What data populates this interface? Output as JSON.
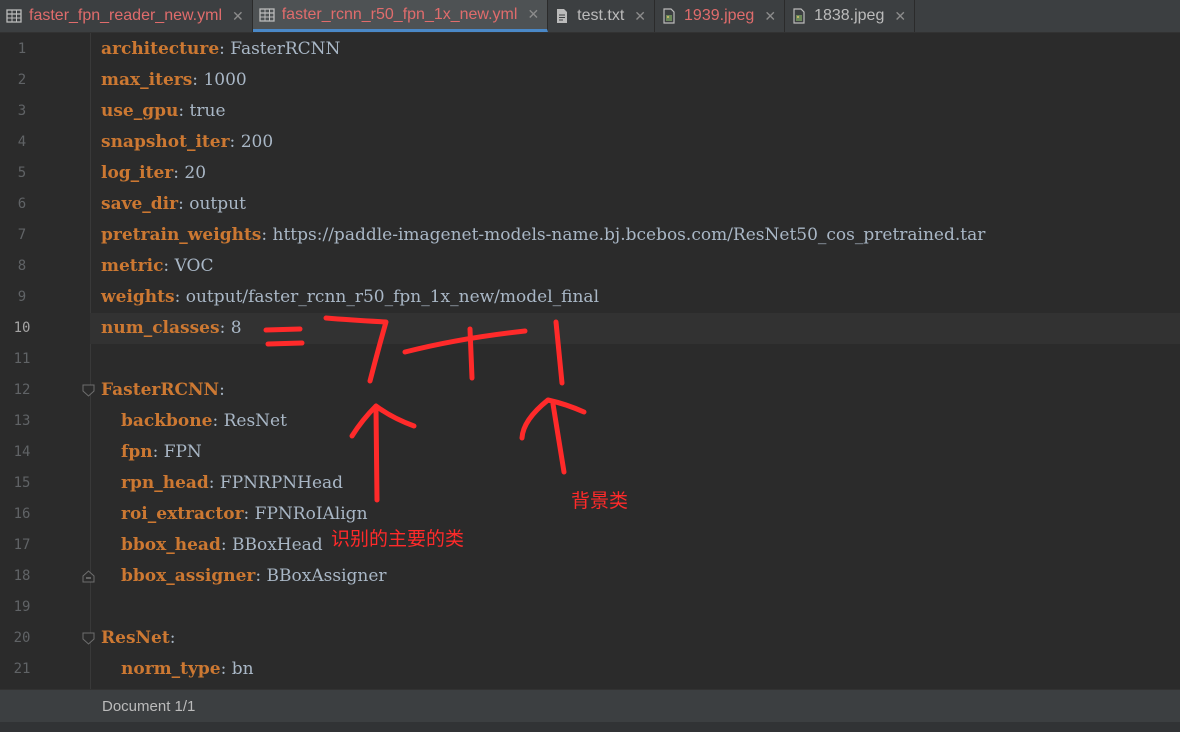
{
  "tabs": [
    {
      "label": "faster_fpn_reader_new.yml",
      "icon": "table-icon",
      "color": "#e06c6c",
      "active": false
    },
    {
      "label": "faster_rcnn_r50_fpn_1x_new.yml",
      "icon": "table-icon",
      "color": "#e06c6c",
      "active": true
    },
    {
      "label": "test.txt",
      "icon": "text-file-icon",
      "color": "#bbbbbb",
      "active": false
    },
    {
      "label": "1939.jpeg",
      "icon": "image-file-icon",
      "color": "#e06c6c",
      "active": false
    },
    {
      "label": "1838.jpeg",
      "icon": "image-file-icon",
      "color": "#bbbbbb",
      "active": false
    }
  ],
  "editor": {
    "current_line": 10,
    "lines": [
      {
        "num": "1",
        "indent": 0,
        "key": "architecture",
        "value": "FasterRCNN"
      },
      {
        "num": "2",
        "indent": 0,
        "key": "max_iters",
        "value": "1000"
      },
      {
        "num": "3",
        "indent": 0,
        "key": "use_gpu",
        "value": "true"
      },
      {
        "num": "4",
        "indent": 0,
        "key": "snapshot_iter",
        "value": "200"
      },
      {
        "num": "5",
        "indent": 0,
        "key": "log_iter",
        "value": "20"
      },
      {
        "num": "6",
        "indent": 0,
        "key": "save_dir",
        "value": "output"
      },
      {
        "num": "7",
        "indent": 0,
        "key": "pretrain_weights",
        "value": "https://paddle-imagenet-models-name.bj.bcebos.com/ResNet50_cos_pretrained.tar"
      },
      {
        "num": "8",
        "indent": 0,
        "key": "metric",
        "value": "VOC"
      },
      {
        "num": "9",
        "indent": 0,
        "key": "weights",
        "value": "output/faster_rcnn_r50_fpn_1x_new/model_final"
      },
      {
        "num": "10",
        "indent": 0,
        "key": "num_classes",
        "value": "8"
      },
      {
        "num": "11",
        "indent": 0,
        "key": "",
        "value": ""
      },
      {
        "num": "12",
        "indent": 0,
        "key": "FasterRCNN",
        "value": "",
        "fold": "open"
      },
      {
        "num": "13",
        "indent": 1,
        "key": "backbone",
        "value": "ResNet"
      },
      {
        "num": "14",
        "indent": 1,
        "key": "fpn",
        "value": "FPN"
      },
      {
        "num": "15",
        "indent": 1,
        "key": "rpn_head",
        "value": "FPNRPNHead"
      },
      {
        "num": "16",
        "indent": 1,
        "key": "roi_extractor",
        "value": "FPNRoIAlign"
      },
      {
        "num": "17",
        "indent": 1,
        "key": "bbox_head",
        "value": "BBoxHead"
      },
      {
        "num": "18",
        "indent": 1,
        "key": "bbox_assigner",
        "value": "BBoxAssigner",
        "fold": "close"
      },
      {
        "num": "19",
        "indent": 0,
        "key": "",
        "value": ""
      },
      {
        "num": "20",
        "indent": 0,
        "key": "ResNet",
        "value": "",
        "fold": "open"
      },
      {
        "num": "21",
        "indent": 1,
        "key": "norm_type",
        "value": "bn"
      }
    ]
  },
  "status": {
    "document": "Document 1/1"
  },
  "annotations": {
    "main_classes_label": "识别的主要的类",
    "background_label": "背景类",
    "color": "#ff2a2a"
  }
}
